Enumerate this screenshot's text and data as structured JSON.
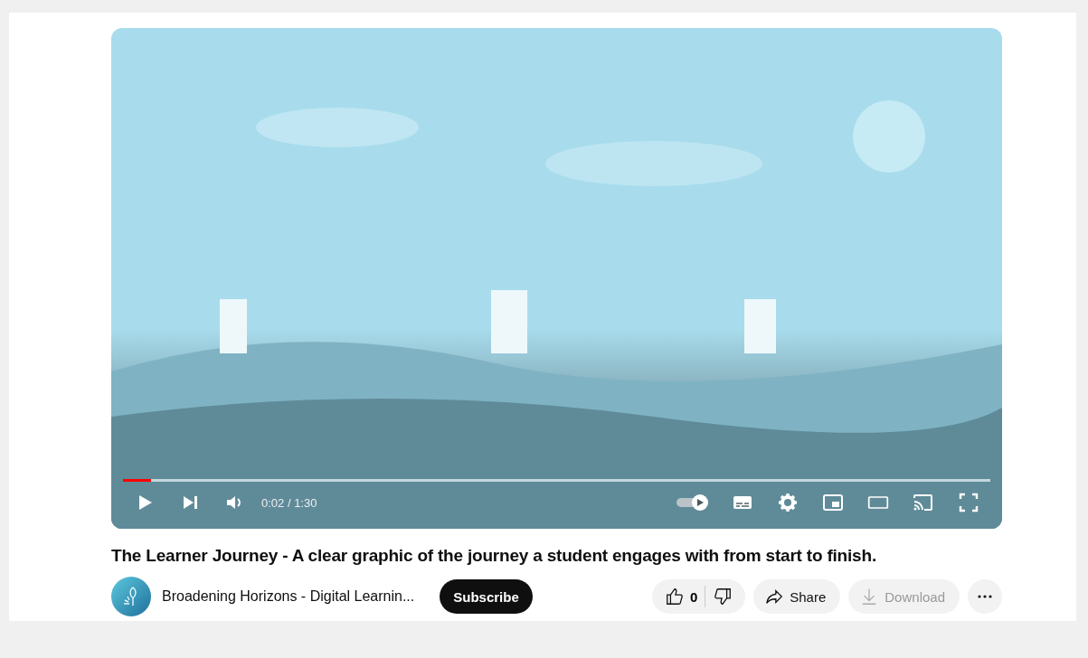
{
  "player": {
    "progress": {
      "level": 0.032
    },
    "time": "0:02 / 1:30",
    "autoplay": {
      "on": true
    }
  },
  "video_title": "The Learner Journey - A clear graphic of the journey a student engages with from start to finish.",
  "channel": {
    "name": "Broadening Horizons - Digital Learnin...",
    "subscribe": "Subscribe"
  },
  "actions": {
    "likes": "0",
    "share": "Share",
    "download": {
      "label": "Download",
      "disabled": true
    }
  }
}
